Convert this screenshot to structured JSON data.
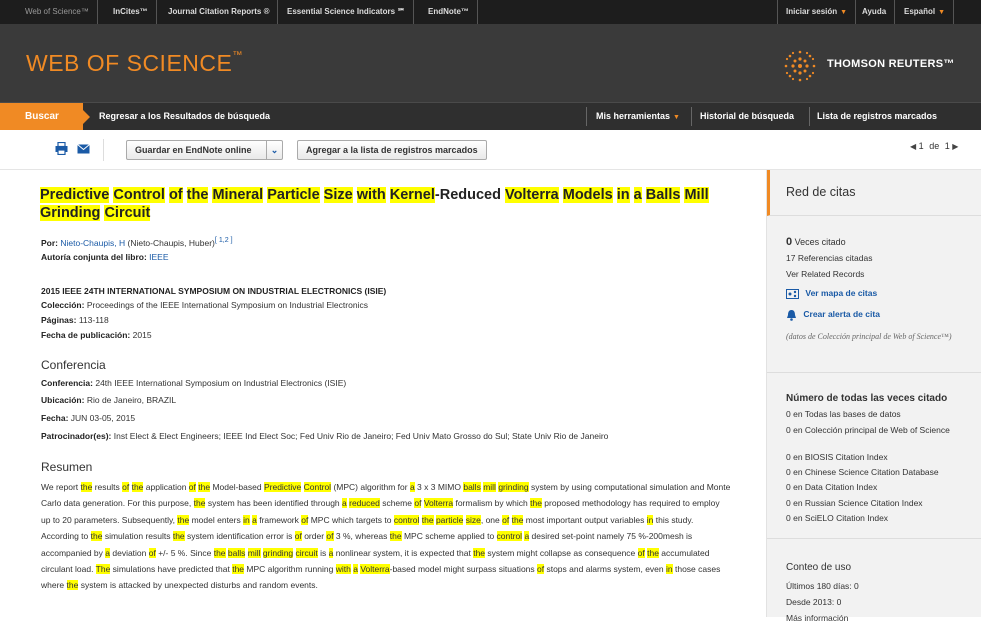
{
  "topbar": {
    "items": [
      "Web of Science™",
      "InCites™",
      "Journal Citation Reports ®",
      "Essential Science Indicators ℠",
      "EndNote™"
    ],
    "right": {
      "signin": "Iniciar sesión",
      "help": "Ayuda",
      "language": "Español"
    }
  },
  "header": {
    "logo": "WEB OF SCIENCE",
    "logo_tm": "™",
    "brand": "THOMSON REUTERS",
    "brand_tm": "™"
  },
  "nav": {
    "search": "Buscar",
    "back": "Regresar a los Resultados de búsqueda",
    "tools": "Mis herramientas",
    "history": "Historial de búsqueda",
    "marked": "Lista de registros marcados"
  },
  "toolbar": {
    "endnote": "Guardar en EndNote online",
    "add_marked": "Agregar a la lista de registros marcados",
    "page_current": "1",
    "page_of": "de",
    "page_total": "1"
  },
  "record": {
    "authors_label": "Por:",
    "author_link": "Nieto-Chaupis, H",
    "author_full": "(Nieto-Chaupis, Huber)",
    "author_refs": "[ 1,2 ]",
    "book_author_label": "Autoría conjunta del libro:",
    "book_author": "IEEE",
    "symposium": "2015 IEEE 24TH INTERNATIONAL SYMPOSIUM ON INDUSTRIAL ELECTRONICS (ISIE)",
    "collection_label": "Colección:",
    "collection": "Proceedings of the IEEE International Symposium on Industrial Electronics",
    "pages_label": "Páginas:",
    "pages": "113-118",
    "pubdate_label": "Fecha de publicación:",
    "pubdate": "2015",
    "conf_heading": "Conferencia",
    "conf_label": "Conferencia:",
    "conf": "24th IEEE International Symposium on Industrial Electronics (ISIE)",
    "loc_label": "Ubicación:",
    "loc": "Rio de Janeiro, BRAZIL",
    "date_label": "Fecha:",
    "date": "JUN 03-05, 2015",
    "sponsors_label": "Patrocinador(es):",
    "sponsors": "Inst Elect & Elect Engineers; IEEE Ind Elect Soc; Fed Univ Rio de Janeiro; Fed Univ Mato Grosso do Sul; State Univ Rio de Janeiro",
    "abstract_heading": "Resumen"
  },
  "sidebar": {
    "citation_network": "Red de citas",
    "times_cited_count": "0",
    "times_cited_label": "Veces citado",
    "refs_cited": "17 Referencias citadas",
    "related": "Ver Related Records",
    "citation_map": "Ver mapa de citas",
    "alert": "Crear alerta de cita",
    "note": "(datos de Colección principal de Web of Science™)",
    "all_times_heading": "Número de todas las veces citado",
    "all_times": [
      "0 en Todas las bases de datos",
      "0 en Colección principal de Web of Science",
      "0 en BIOSIS Citation Index",
      "0 en Chinese Science Citation Database",
      "0 en Data Citation Index",
      "0 en Russian Science Citation Index",
      "0 en SciELO Citation Index"
    ],
    "usage_heading": "Conteo de uso",
    "last180": "Últimos 180 días: 0",
    "since2013": "Desde 2013: 0",
    "more_info": "Más información"
  },
  "colors": {
    "accent": "#f08a24",
    "highlight": "#ffff00",
    "link": "#1a5aa6"
  }
}
